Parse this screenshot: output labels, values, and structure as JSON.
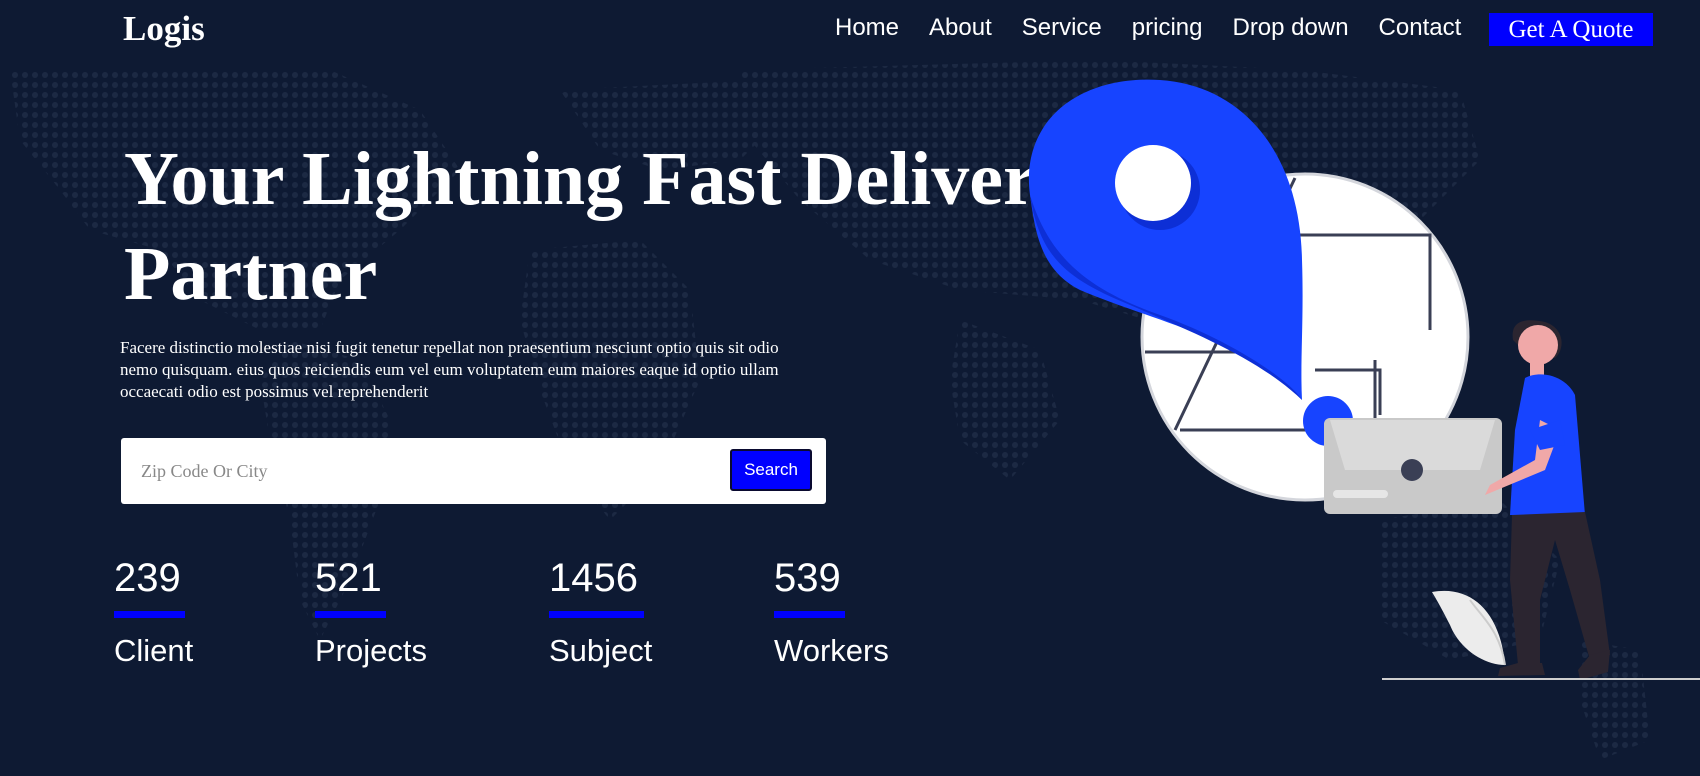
{
  "header": {
    "logo": "Logis",
    "nav": [
      "Home",
      "About",
      "Service",
      "pricing",
      "Drop down",
      "Contact"
    ],
    "cta_label": "Get A Quote"
  },
  "hero": {
    "title_line1": "Your Lightning Fast Delivery",
    "title_line2": "Partner",
    "description": "Facere distinctio molestiae nisi fugit tenetur repellat non praesentium nesciunt optio quis sit odio nemo quisquam. eius quos reiciendis eum vel eum voluptatem eum maiores eaque id optio ullam occaecati odio est possimus vel reprehenderit"
  },
  "search": {
    "placeholder": "Zip Code Or City",
    "button_label": "Search"
  },
  "stats": [
    {
      "value": "239",
      "label": "Client"
    },
    {
      "value": "521",
      "label": "Projects"
    },
    {
      "value": "1456",
      "label": "Subject"
    },
    {
      "value": "539",
      "label": "Workers"
    }
  ],
  "colors": {
    "background": "#0e1a33",
    "accent": "#0000ff",
    "pin_blue": "#1744ff",
    "text": "#ffffff"
  },
  "icons": [
    "location-pin-icon",
    "map-circle-icon",
    "laptop-icon",
    "person-illustration",
    "leaf-icon"
  ]
}
